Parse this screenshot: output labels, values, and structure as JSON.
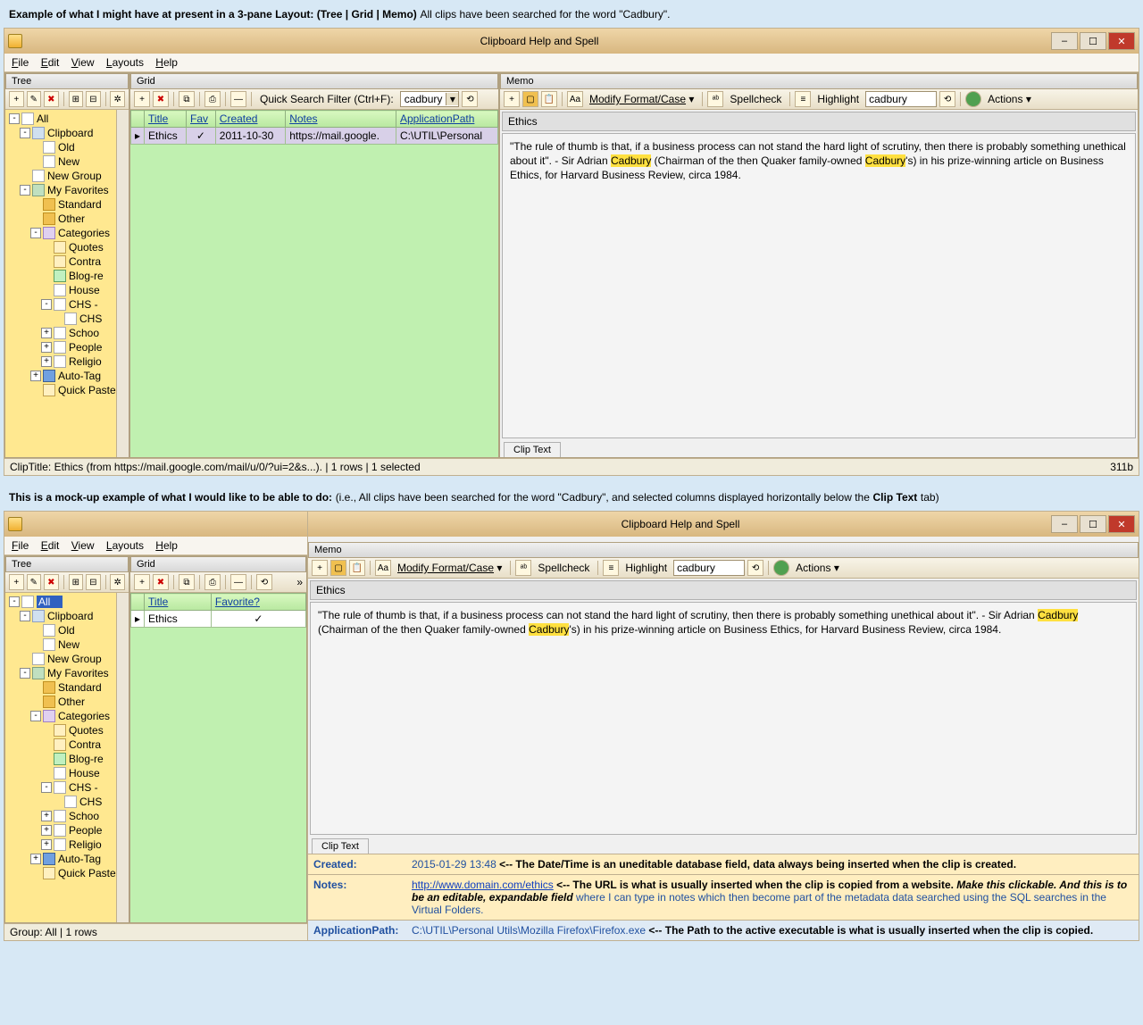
{
  "caption1_bold": "Example of what I might have at present in a 3-pane Layout: (Tree | Grid | Memo)",
  "caption1_rest": "All clips have been searched for the word \"Cadbury\".",
  "caption2_bold1": "This is a mock-up example of what I would like to be able to do:",
  "caption2_rest": "(i.e., All clips have been searched for the word \"Cadbury\", and selected columns displayed horizontally below the",
  "caption2_bold2": "Clip Text",
  "caption2_tail": "tab)",
  "app_title": "Clipboard Help and Spell",
  "menus": [
    "File",
    "Edit",
    "View",
    "Layouts",
    "Help"
  ],
  "pane_labels": {
    "tree": "Tree",
    "grid": "Grid",
    "memo": "Memo"
  },
  "tree_nodes": [
    {
      "d": 0,
      "exp": "-",
      "icon": "ic-page",
      "label": "All",
      "sel": false
    },
    {
      "d": 1,
      "exp": "-",
      "icon": "ic-clip",
      "label": "Clipboard"
    },
    {
      "d": 2,
      "exp": "",
      "icon": "ic-page",
      "label": "Old"
    },
    {
      "d": 2,
      "exp": "",
      "icon": "ic-page",
      "label": "New"
    },
    {
      "d": 1,
      "exp": "",
      "icon": "ic-page",
      "label": "New Group"
    },
    {
      "d": 1,
      "exp": "-",
      "icon": "ic-fav",
      "label": "My Favorites"
    },
    {
      "d": 2,
      "exp": "",
      "icon": "ic-fold",
      "label": "Standard"
    },
    {
      "d": 2,
      "exp": "",
      "icon": "ic-fold",
      "label": "Other"
    },
    {
      "d": 2,
      "exp": "-",
      "icon": "ic-cat",
      "label": "Categories"
    },
    {
      "d": 3,
      "exp": "",
      "icon": "ic-note",
      "label": "Quotes"
    },
    {
      "d": 3,
      "exp": "",
      "icon": "ic-note",
      "label": "Contra"
    },
    {
      "d": 3,
      "exp": "",
      "icon": "ic-check",
      "label": "Blog-re"
    },
    {
      "d": 3,
      "exp": "",
      "icon": "ic-page",
      "label": "House"
    },
    {
      "d": 3,
      "exp": "-",
      "icon": "ic-page",
      "label": "CHS -"
    },
    {
      "d": 4,
      "exp": "",
      "icon": "ic-page",
      "label": "CHS"
    },
    {
      "d": 3,
      "exp": "+",
      "icon": "ic-page",
      "label": "Schoo"
    },
    {
      "d": 3,
      "exp": "+",
      "icon": "ic-page",
      "label": "People"
    },
    {
      "d": 3,
      "exp": "+",
      "icon": "ic-page",
      "label": "Religio"
    },
    {
      "d": 2,
      "exp": "+",
      "icon": "ic-blue",
      "label": "Auto-Tag"
    },
    {
      "d": 2,
      "exp": "",
      "icon": "ic-note",
      "label": "Quick Paste"
    }
  ],
  "quick_search_label": "Quick Search Filter (Ctrl+F):",
  "quick_search_value": "cadbury",
  "grid_headers_full": [
    "Title",
    "Fav",
    "Created",
    "Notes",
    "ApplicationPath"
  ],
  "grid_row_full": {
    "title": "Ethics",
    "fav": "✓",
    "created": "2011-10-30",
    "notes": "https://mail.google.",
    "app": "C:\\UTIL\\Personal"
  },
  "grid_headers_small": [
    "Title",
    "Favorite?"
  ],
  "grid_row_small": {
    "title": "Ethics",
    "fav": "✓"
  },
  "memo_toolbar": {
    "modify": "Modify Format/Case",
    "spell": "Spellcheck",
    "highlight": "Highlight",
    "hval": "cadbury",
    "actions": "Actions"
  },
  "memo_title": "Ethics",
  "memo_pre": "\"The rule of thumb is that, if a business process can not stand the hard light of scrutiny, then there is probably something unethical about it\". - Sir Adrian ",
  "memo_hl1": "Cadbury",
  "memo_mid": " (Chairman of the then Quaker family-owned ",
  "memo_hl2": "Cadbury",
  "memo_post": "'s) in his prize-winning article on Business Ethics, for Harvard Business Review, circa 1984.",
  "clip_tab": "Clip Text",
  "status_left": "ClipTitle: Ethics (from https://mail.google.com/mail/u/0/?ui=2&s...).  |  1 rows  |  1 selected",
  "status_right": "311b",
  "status2": "Group: All  |  1 rows",
  "details": {
    "created_lab": "Created:",
    "created_val": "2015-01-29 13:48",
    "created_note": " <-- The Date/Time is an uneditable database field, data always being inserted when the clip is created.",
    "notes_lab": "Notes:",
    "notes_url": "http://www.domain.com/ethics",
    "notes_b1": " <-- The URL is what is usually inserted when the clip is copied from a website. ",
    "notes_i1": "Make this clickable. And this is to be an editable, expandable field",
    "notes_tail": " where I can type in notes which then become part of the metadata data searched using the SQL searches in the Virtual Folders.",
    "app_lab": "ApplicationPath:",
    "app_val": "C:\\UTIL\\Personal Utils\\Mozilla Firefox\\Firefox.exe",
    "app_note": " <-- The Path to the active executable is what is usually inserted when the clip is copied."
  }
}
